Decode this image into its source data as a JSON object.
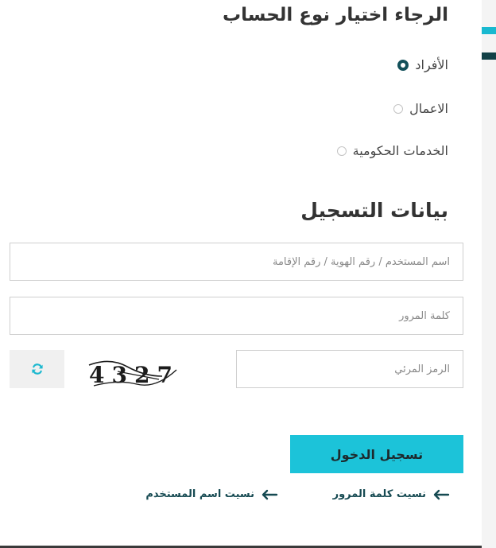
{
  "account_type": {
    "heading": "الرجاء اختيار نوع الحساب",
    "options": [
      {
        "label": "الأفراد",
        "selected": true
      },
      {
        "label": "الاعمال",
        "selected": false
      },
      {
        "label": "الخدمات الحكومية",
        "selected": false
      }
    ]
  },
  "registration": {
    "heading": "بيانات التسجيل",
    "username_placeholder": "اسم المستخدم / رقم الهوية / رقم الإقامة",
    "password_placeholder": "كلمة المرور",
    "captcha_placeholder": "الرمز المرئي",
    "captcha_text": "4327",
    "refresh_icon": "refresh-icon",
    "login_label": "تسجيل الدخول"
  },
  "links": {
    "forgot_password": "نسيت كلمة المرور",
    "forgot_username": "نسيت اسم المستخدم",
    "arrow_icon": "arrow-left-icon"
  },
  "colors": {
    "accent": "#1cc3d9",
    "dark_accent": "#124147",
    "radio_selected": "#12505a"
  }
}
